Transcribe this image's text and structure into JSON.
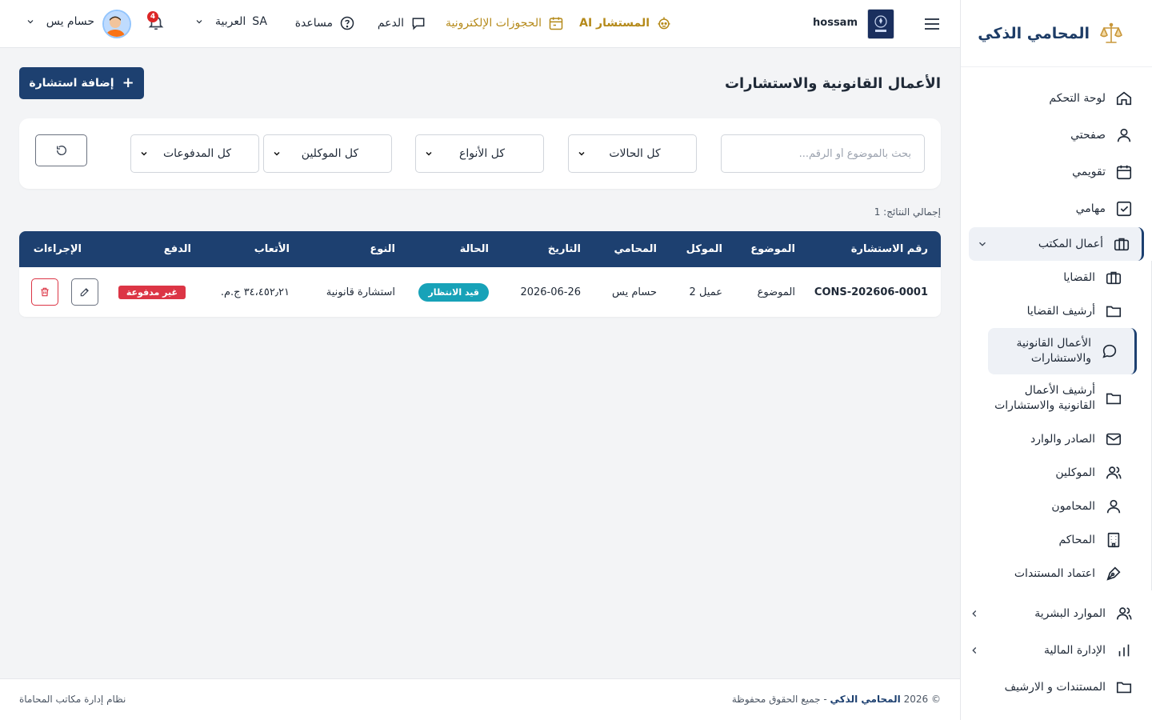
{
  "brand": {
    "title": "المحامي الذكي"
  },
  "header": {
    "username": "hossam",
    "ai_label": "المستشار AI",
    "bookings_label": "الحجوزات الإلكترونية",
    "support_label": "الدعم",
    "help_label": "مساعدة",
    "lang_code": "SA",
    "lang_label": "العربية",
    "notif_count": "4",
    "user_name": "حسام يس"
  },
  "sidebar": {
    "items": [
      {
        "label": "لوحة التحكم"
      },
      {
        "label": "صفحتي"
      },
      {
        "label": "تقويمي"
      },
      {
        "label": "مهامي"
      },
      {
        "label": "أعمال المكتب"
      }
    ],
    "sub": [
      {
        "label": "القضايا"
      },
      {
        "label": "أرشيف القضايا"
      },
      {
        "label": "الأعمال القانونية والاستشارات"
      },
      {
        "label": "أرشيف الأعمال القانونية والاستشارات"
      },
      {
        "label": "الصادر والوارد"
      },
      {
        "label": "الموكلين"
      },
      {
        "label": "المحامون"
      },
      {
        "label": "المحاكم"
      },
      {
        "label": "اعتماد المستندات"
      }
    ],
    "bottom": [
      {
        "label": "الموارد البشرية"
      },
      {
        "label": "الإدارة المالية"
      },
      {
        "label": "المستندات و الارشيف"
      }
    ]
  },
  "main": {
    "title": "الأعمال القانونية والاستشارات",
    "add_label": "إضافة استشارة",
    "search_placeholder": "بحث بالموضوع أو الرقم...",
    "filters": {
      "status": "كل الحالات",
      "types": "كل الأنواع",
      "clients": "كل الموكلين",
      "payments": "كل المدفوعات"
    },
    "total": "إجمالي النتائج: 1"
  },
  "table": {
    "columns": [
      "رقم الاستشارة",
      "الموضوع",
      "الموكل",
      "المحامي",
      "التاريخ",
      "الحالة",
      "النوع",
      "الأتعاب",
      "الدفع",
      "الإجراءات"
    ],
    "rows": [
      {
        "number": "CONS-202606-0001",
        "subject": "الموضوع",
        "client": "عميل 2",
        "lawyer": "حسام يس",
        "date": "2026-06-26",
        "status": "قيد الانتظار",
        "type": "استشارة قانونية",
        "fees": "٣٤،٤٥٢٫٢١ ج.م.",
        "payment": "غير مدفوعة"
      }
    ]
  },
  "footer": {
    "copy_prefix": "© 2026",
    "copy_brand": "المحامي الذكي",
    "copy_suffix": "- جميع الحقوق محفوظة",
    "right_text": "نظام إدارة مكاتب المحاماة"
  }
}
